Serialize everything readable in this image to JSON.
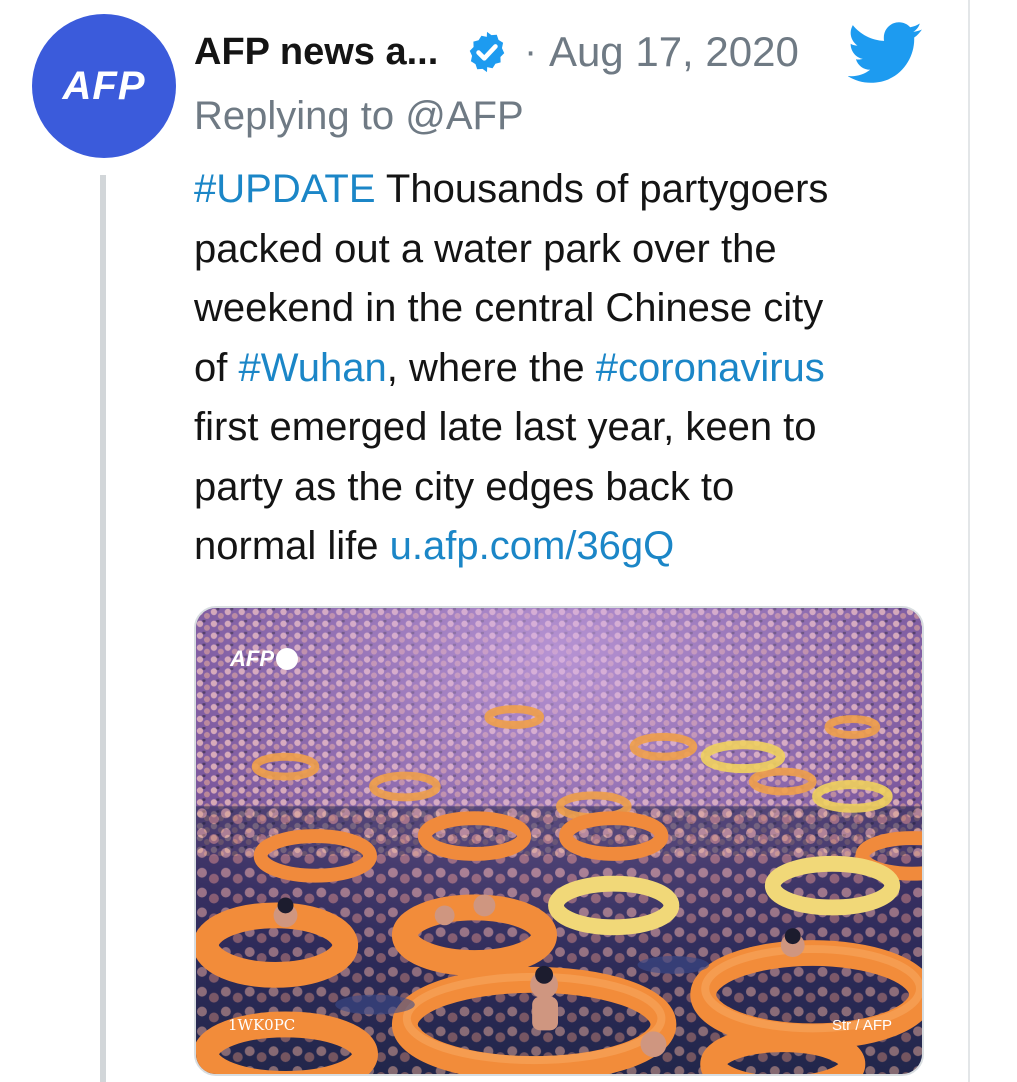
{
  "tweet": {
    "author": {
      "name": "AFP news a...",
      "avatar_text": "AFP",
      "verified": true
    },
    "separator": "·",
    "date": "Aug 17, 2020",
    "reply_context": "Replying to @AFP",
    "body": {
      "hashtag_update": "#UPDATE",
      "text_1": " Thousands of partygoers",
      "text_2": "packed out a water park over the",
      "text_3": "weekend in the central Chinese city",
      "text_4a": "of ",
      "hashtag_wuhan": "#Wuhan",
      "text_4b": ", where the ",
      "hashtag_coronavirus": "#coronavirus",
      "text_5": "first emerged late last year, keen to",
      "text_6": "party as the city edges back to",
      "text_7a": "normal life ",
      "link": "u.afp.com/36gQ"
    },
    "media": {
      "watermark_logo": "AFP",
      "image_code": "1WK0PC",
      "credit": "Str / AFP"
    }
  },
  "icons": {
    "verified": "verified-badge-icon",
    "brand": "twitter-bird-icon"
  },
  "colors": {
    "link": "#1b86c7",
    "avatar": "#3b5bdb",
    "muted": "#6f7a84",
    "verified": "#1d9bf0",
    "twitter_brand": "#1d9bf0"
  }
}
